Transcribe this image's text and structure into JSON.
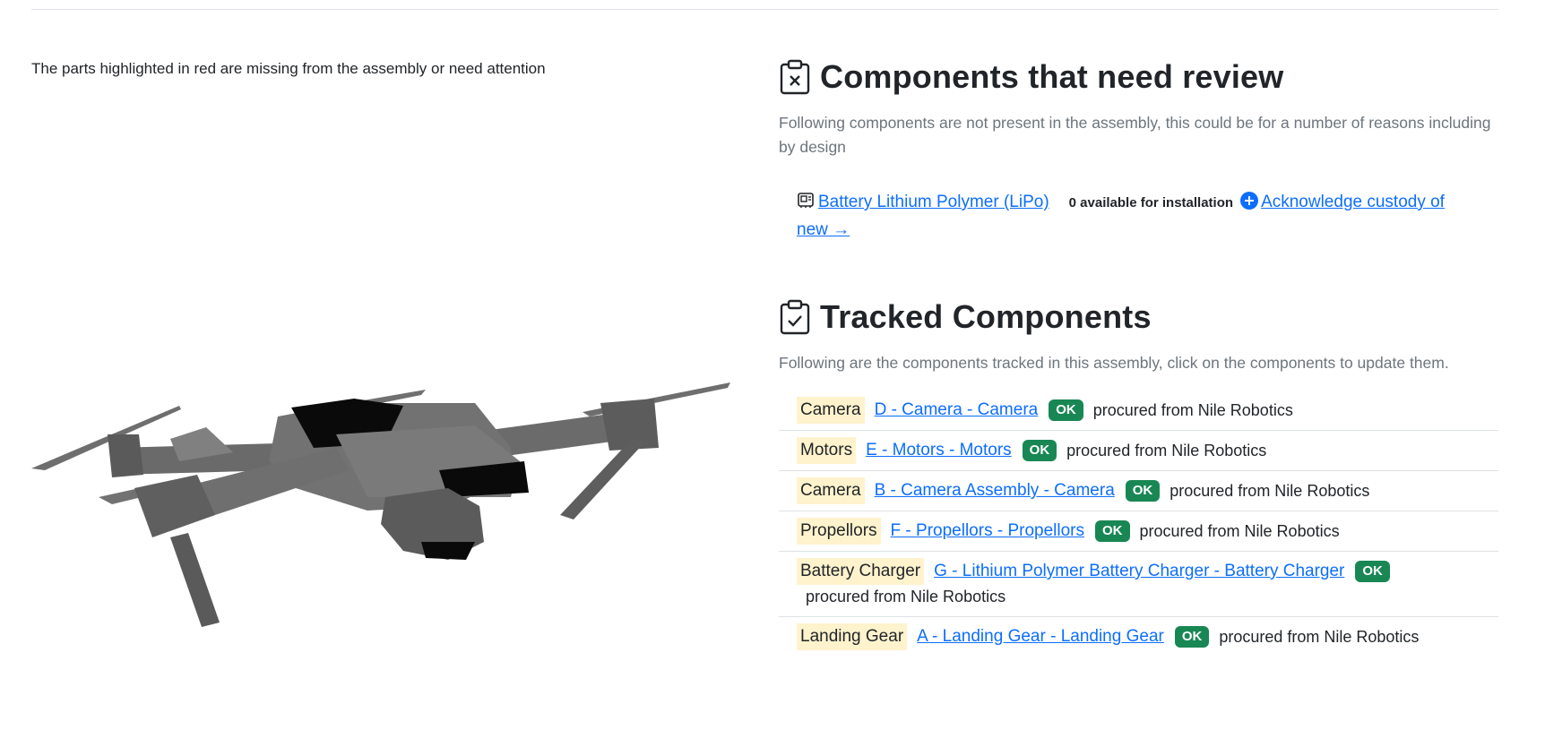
{
  "left": {
    "note": "The parts highlighted in red are missing from the assembly or need attention"
  },
  "review": {
    "title": "Components that need review",
    "icon": "clipboard-x-icon",
    "description": "Following components are not present in the assembly, this could be for a number of reasons including by design",
    "missing_item": {
      "icon": "chip-icon",
      "name": "Battery Lithium Polymer (LiPo)",
      "availability": "0 available for installation",
      "action_icon": "plus-circle-icon",
      "action_label": "Acknowledge custody of new →"
    }
  },
  "tracked": {
    "title": "Tracked Components",
    "icon": "clipboard-check-icon",
    "description": "Following are the components tracked in this assembly, click on the components to update them.",
    "items": [
      {
        "category": "Camera",
        "link": "D - Camera - Camera",
        "status": "OK",
        "source": "procured from Nile Robotics"
      },
      {
        "category": "Motors",
        "link": "E - Motors - Motors",
        "status": "OK",
        "source": "procured from Nile Robotics"
      },
      {
        "category": "Camera",
        "link": "B - Camera Assembly - Camera",
        "status": "OK",
        "source": "procured from Nile Robotics"
      },
      {
        "category": "Propellors",
        "link": "F - Propellors - Propellors",
        "status": "OK",
        "source": "procured from Nile Robotics"
      },
      {
        "category": "Battery Charger",
        "link": "G - Lithium Polymer Battery Charger - Battery Charger",
        "status": "OK",
        "source": "procured from Nile Robotics"
      },
      {
        "category": "Landing Gear",
        "link": "A - Landing Gear - Landing Gear",
        "status": "OK",
        "source": "procured from Nile Robotics"
      }
    ]
  },
  "colors": {
    "link": "#0d6efd",
    "ok_badge": "#198754",
    "category_highlight": "#fff3cd",
    "muted_text": "#6c757d"
  }
}
